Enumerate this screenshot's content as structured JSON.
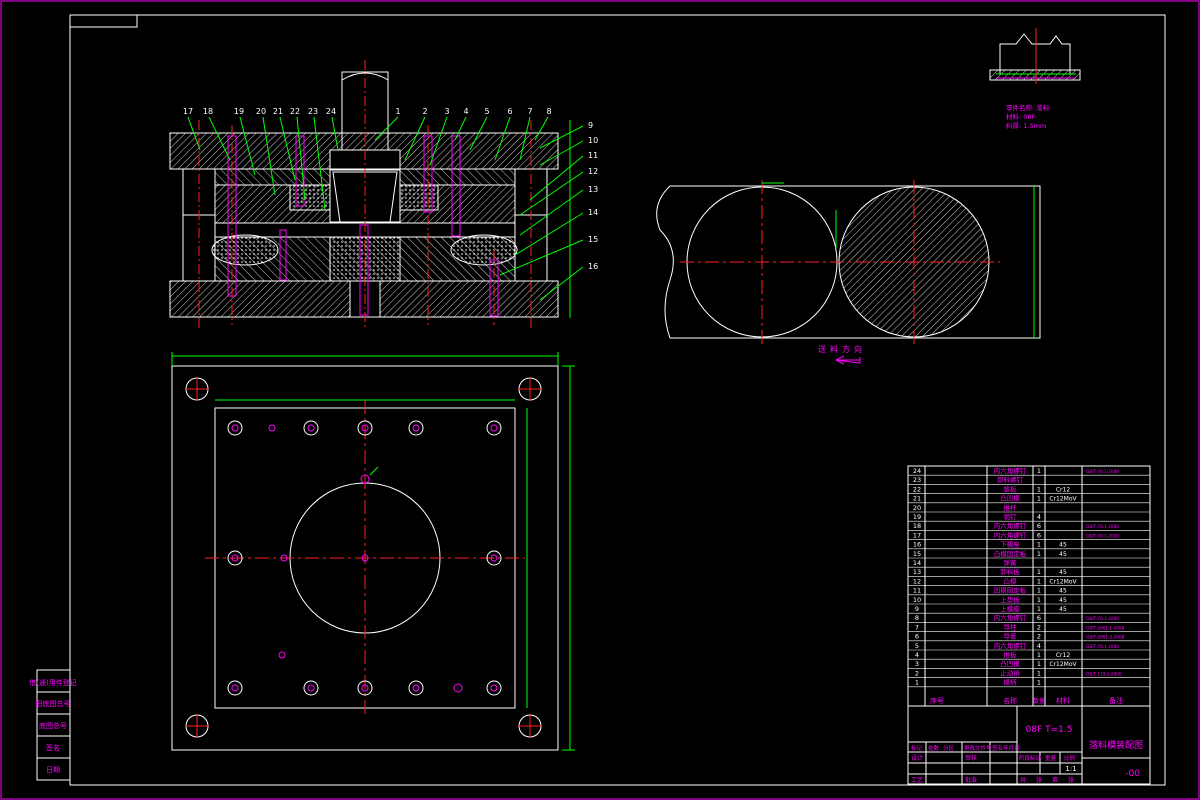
{
  "title_block": {
    "material_thickness": "08F T=1.5",
    "drawing_name": "落料模装配图",
    "drawing_number": "-00",
    "scale": "1:1"
  },
  "bom": {
    "headers": [
      "序号",
      "名称",
      "数量",
      "材料",
      "备注"
    ],
    "rows": [
      {
        "no": "24",
        "name": "内六角螺钉",
        "qty": "1",
        "material": "",
        "note": "GB/T 70.1-2000"
      },
      {
        "no": "23",
        "name": "卸料螺钉",
        "qty": "",
        "material": "",
        "note": ""
      },
      {
        "no": "22",
        "name": "垫板",
        "qty": "1",
        "material": "Cr12",
        "note": ""
      },
      {
        "no": "21",
        "name": "凸凹模",
        "qty": "1",
        "material": "Cr12MoV",
        "note": ""
      },
      {
        "no": "20",
        "name": "推杆",
        "qty": "",
        "material": "",
        "note": ""
      },
      {
        "no": "19",
        "name": "销钉",
        "qty": "4",
        "material": "",
        "note": ""
      },
      {
        "no": "18",
        "name": "内六角螺钉",
        "qty": "6",
        "material": "",
        "note": "GB/T 70.1-2000"
      },
      {
        "no": "17",
        "name": "内六角螺钉",
        "qty": "6",
        "material": "",
        "note": "GB/T 70.1-2000"
      },
      {
        "no": "16",
        "name": "下模座",
        "qty": "1",
        "material": "45",
        "note": ""
      },
      {
        "no": "15",
        "name": "凸模固定板",
        "qty": "1",
        "material": "45",
        "note": ""
      },
      {
        "no": "14",
        "name": "弹簧",
        "qty": "",
        "material": "",
        "note": ""
      },
      {
        "no": "13",
        "name": "卸料板",
        "qty": "1",
        "material": "45",
        "note": ""
      },
      {
        "no": "12",
        "name": "凸模",
        "qty": "1",
        "material": "Cr12MoV",
        "note": ""
      },
      {
        "no": "11",
        "name": "凹模固定板",
        "qty": "1",
        "material": "45",
        "note": ""
      },
      {
        "no": "10",
        "name": "上垫板",
        "qty": "1",
        "material": "45",
        "note": ""
      },
      {
        "no": "9",
        "name": "上模座",
        "qty": "1",
        "material": "45",
        "note": ""
      },
      {
        "no": "8",
        "name": "内六角螺钉",
        "qty": "6",
        "material": "",
        "note": "GB/T 70.1-2000"
      },
      {
        "no": "7",
        "name": "导柱",
        "qty": "2",
        "material": "",
        "note": "GB/T 2861.1-2008"
      },
      {
        "no": "6",
        "name": "导套",
        "qty": "2",
        "material": "",
        "note": "GB/T 2861.3-2008"
      },
      {
        "no": "5",
        "name": "内六角螺钉",
        "qty": "4",
        "material": "",
        "note": "GB/T 70.1-2000"
      },
      {
        "no": "4",
        "name": "推板",
        "qty": "1",
        "material": "Cr12",
        "note": ""
      },
      {
        "no": "3",
        "name": "凸凹模",
        "qty": "1",
        "material": "Cr12MoV",
        "note": ""
      },
      {
        "no": "2",
        "name": "止动销",
        "qty": "1",
        "material": "",
        "note": "GB/T 119.1-2000"
      },
      {
        "no": "1",
        "name": "模柄",
        "qty": "1",
        "material": "",
        "note": ""
      }
    ]
  },
  "title_labels": {
    "revision": [
      "标记",
      "处数",
      "分区",
      "更改文件号",
      "签名",
      "年月日"
    ],
    "roles": [
      "设计",
      "审核",
      "工艺",
      "批准"
    ],
    "stage": [
      "阶段标记",
      "重量",
      "比例"
    ],
    "sheet": [
      "共",
      "张",
      "第",
      "张"
    ]
  },
  "left_strip": [
    "借(通)用件登记",
    "旧底图总号",
    "底图总号",
    "签名",
    "日期"
  ],
  "part_note": [
    "零件名称: 落料",
    "材料: 08F",
    "料厚: 1.5mm"
  ],
  "feed_direction": "送料方向",
  "section_labels": [
    "17",
    "18",
    "19",
    "20",
    "21",
    "22",
    "23",
    "24",
    "1",
    "2",
    "3",
    "4",
    "5",
    "6",
    "7",
    "8",
    "9",
    "10",
    "11",
    "12",
    "13",
    "14",
    "15",
    "16"
  ],
  "colors": {
    "border": "#ff00ff",
    "outline": "#ffffff",
    "center": "#ff2020",
    "dimension": "#00ff00",
    "hatch": "#ffffff"
  }
}
